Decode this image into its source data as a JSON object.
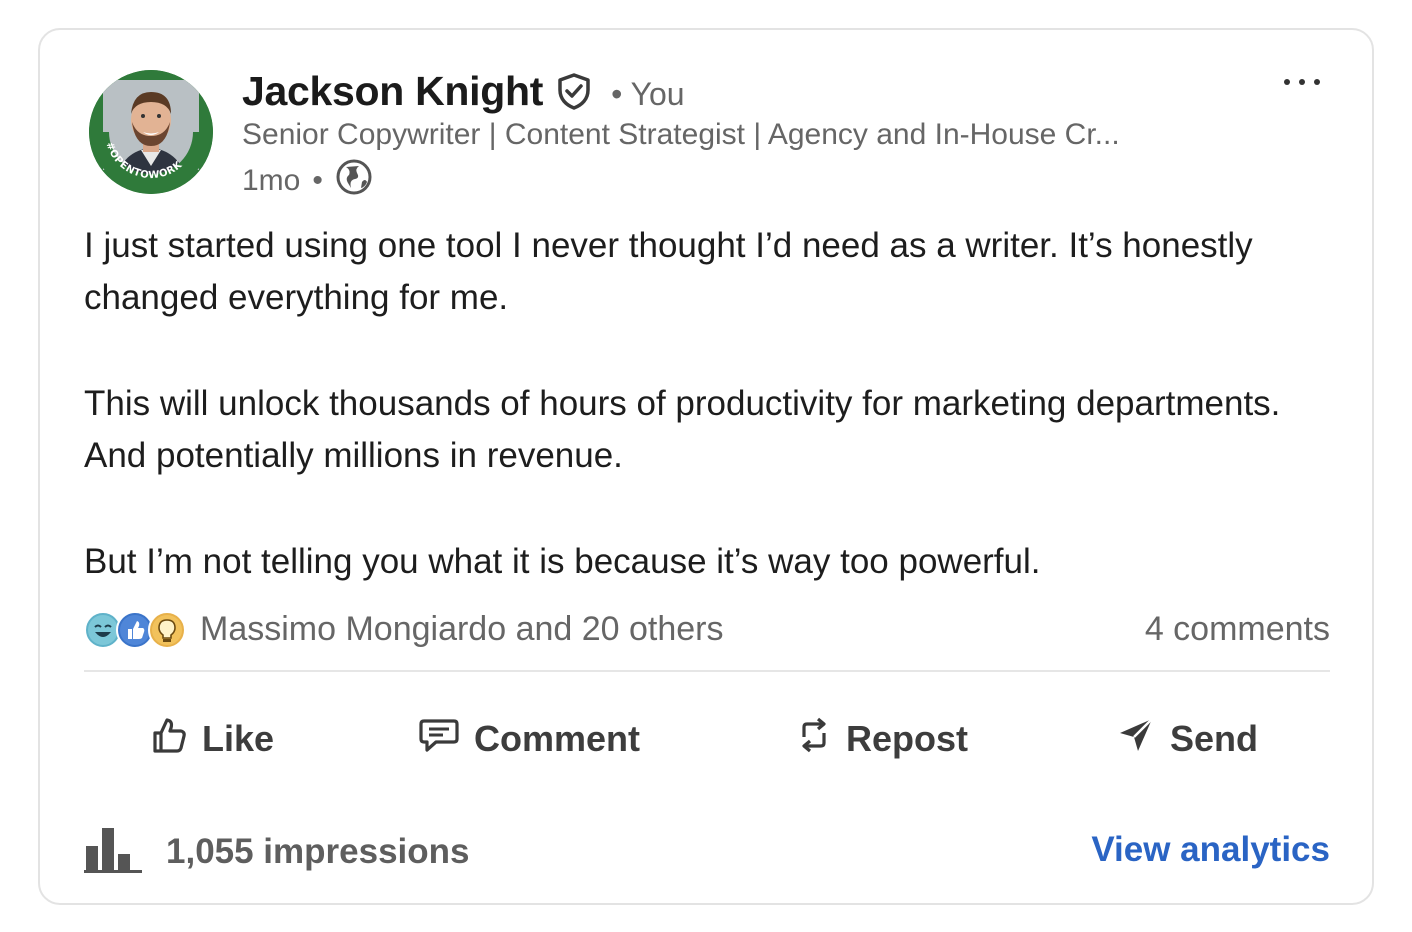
{
  "post": {
    "author": {
      "name": "Jackson Knight",
      "relation": "You",
      "headline": "Senior Copywriter | Content Strategist | Agency and In-House Cr...",
      "time": "1mo",
      "visibility_icon": "globe-icon",
      "avatar_frame_text": "#OPENTOWORK"
    },
    "body": [
      "I just started using one tool I never thought I’d need as a writer. It’s honestly changed everything for me.",
      "This will unlock thousands of hours of productivity for marketing departments. And potentially millions in revenue.",
      "But I’m not telling you what it is because it’s way too powerful."
    ],
    "reactions": {
      "icons": [
        "funny-reaction-icon",
        "like-reaction-icon",
        "insightful-reaction-icon"
      ],
      "summary": "Massimo Mongiardo and 20 others",
      "comments": "4 comments"
    },
    "actions": {
      "like": "Like",
      "comment": "Comment",
      "repost": "Repost",
      "send": "Send"
    },
    "footer": {
      "impressions": "1,055 impressions",
      "view_analytics": "View analytics"
    }
  },
  "colors": {
    "open_to_work_green": "#2f7a3a",
    "link_blue": "#2a64c4",
    "text_secondary": "#666666",
    "border": "#e3e3e3"
  }
}
